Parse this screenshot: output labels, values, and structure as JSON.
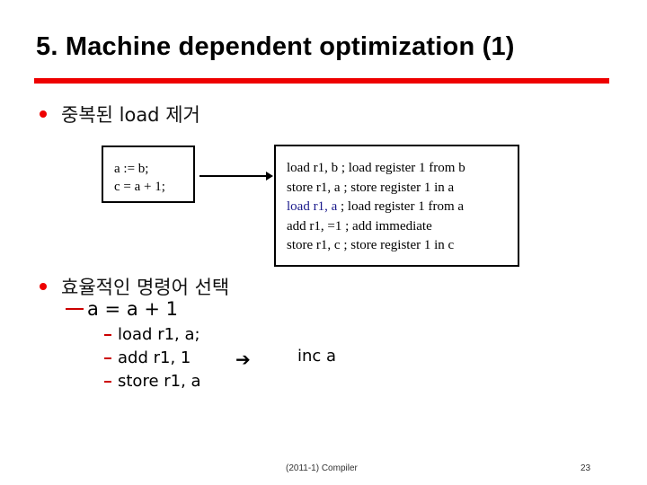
{
  "slide": {
    "title": "5. Machine dependent optimization (1)",
    "accent_color": "#ee0000",
    "bullets": [
      {
        "text": "중복된 load 제거"
      },
      {
        "text": "효율적인 명령어 선택"
      }
    ],
    "source_box": {
      "lines": [
        "a := b;",
        "c = a + 1;"
      ]
    },
    "target_box": {
      "lines": [
        {
          "code": "load r1, b",
          "comment": " ; load register 1 from b",
          "highlight": false
        },
        {
          "code": "store r1, a",
          "comment": " ; store register 1 in a",
          "highlight": false
        },
        {
          "code": "load r1, a",
          "comment": " ; load register 1  from a",
          "highlight": true
        },
        {
          "code": "add r1, =1",
          "comment": " ; add immediate",
          "highlight": false
        },
        {
          "code": "store r1, c",
          "comment": " ; store register 1 in c",
          "highlight": false
        }
      ]
    },
    "sub_bullet": "a = a + 1",
    "instructions": [
      "load r1, a;",
      "add r1, 1",
      "store r1, a"
    ],
    "arrow_icon": "➔",
    "result": "inc a",
    "footer": {
      "course": "(2011-1) Compiler",
      "page": "23"
    }
  }
}
